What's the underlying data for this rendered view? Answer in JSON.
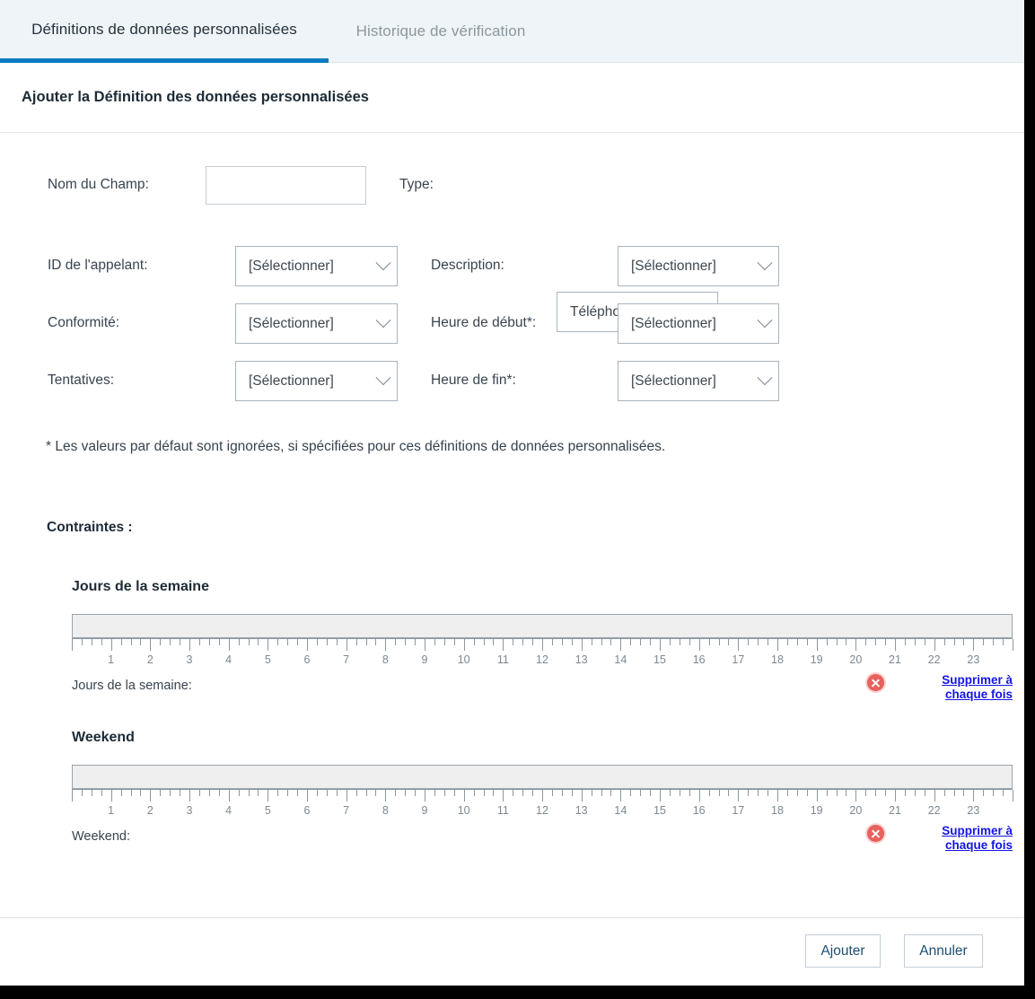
{
  "tabs": [
    {
      "label": "Définitions de données personnalisées",
      "active": true
    },
    {
      "label": "Historique de vérification",
      "active": false
    }
  ],
  "dialog": {
    "heading": "Ajouter la Définition des données personnalisées",
    "footnote": "* Les valeurs par défaut sont ignorées, si spécifiées pour ces définitions de données personnalisées."
  },
  "form": {
    "field_name": {
      "label": "Nom du Champ:",
      "value": "",
      "placeholder": ""
    },
    "type": {
      "label": "Type:",
      "value": "Téléphone"
    },
    "caller_id": {
      "label": "ID de l'appelant:",
      "value": "[Sélectionner]"
    },
    "description": {
      "label": "Description:",
      "value": "[Sélectionner]"
    },
    "compliance": {
      "label": "Conformité:",
      "value": "[Sélectionner]"
    },
    "start_time": {
      "label": "Heure de début*:",
      "value": "[Sélectionner]"
    },
    "attempts": {
      "label": "Tentatives:",
      "value": "[Sélectionner]"
    },
    "end_time": {
      "label": "Heure de fin*:",
      "value": "[Sélectionner]"
    }
  },
  "constraints": {
    "title": "Contraintes :",
    "weekday": {
      "heading": "Jours de la semaine",
      "footer_label": "Jours de la semaine:",
      "clear_link": "Supprimer à chaque fois",
      "delete_icon": "delete-circle-icon"
    },
    "weekend": {
      "heading": "Weekend",
      "footer_label": "Weekend:",
      "clear_link": "Supprimer à chaque fois",
      "delete_icon": "delete-circle-icon"
    },
    "ruler": {
      "min": 0,
      "max": 24,
      "minor_per_major": 4,
      "labels": [
        "1",
        "2",
        "3",
        "4",
        "5",
        "6",
        "7",
        "8",
        "9",
        "10",
        "11",
        "12",
        "13",
        "14",
        "15",
        "16",
        "17",
        "18",
        "19",
        "20",
        "21",
        "22",
        "23"
      ]
    }
  },
  "footer": {
    "add_label": "Ajouter",
    "cancel_label": "Annuler"
  },
  "colors": {
    "accent": "#0a7ac2",
    "tabbar_bg": "#eff4f8",
    "link": "#1414e8",
    "delete": "#e8615c",
    "track": "#efefef"
  }
}
